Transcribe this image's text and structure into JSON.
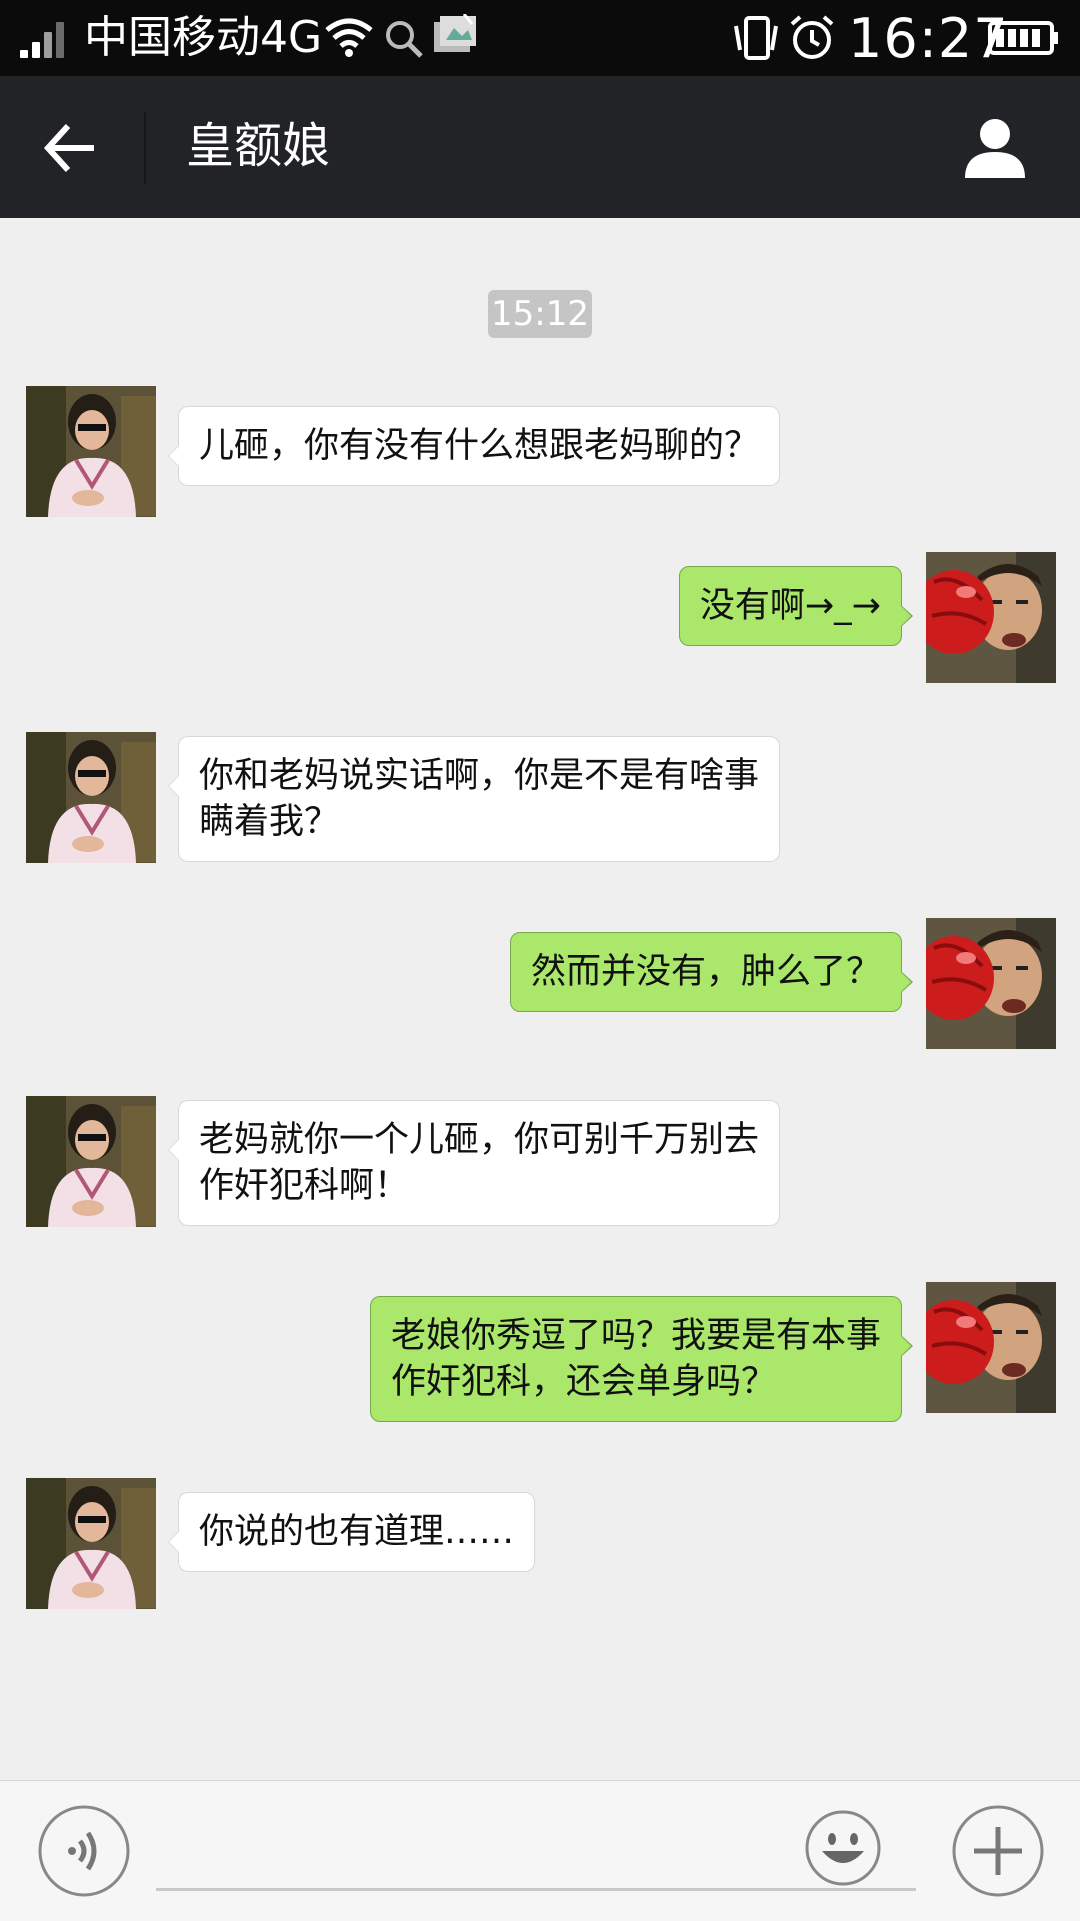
{
  "status_bar": {
    "carrier": "中国移动4G",
    "time": "16:27"
  },
  "header": {
    "title": "皇额娘"
  },
  "chat": {
    "timestamp": "15:12",
    "messages": [
      {
        "from": "mom",
        "text": "儿砸，你有没有什么想跟老妈聊的？"
      },
      {
        "from": "me",
        "text": "没有啊→_→"
      },
      {
        "from": "mom",
        "lines": [
          "你和老妈说实话啊，你是不是有啥事",
          "瞒着我？"
        ]
      },
      {
        "from": "me",
        "text": "然而并没有，肿么了？"
      },
      {
        "from": "mom",
        "lines": [
          "老妈就你一个儿砸，你可别千万别去",
          "作奸犯科啊！"
        ]
      },
      {
        "from": "me",
        "lines": [
          "老娘你秀逗了吗？我要是有本事",
          "作奸犯科，还会单身吗？"
        ]
      },
      {
        "from": "mom",
        "text": "你说的也有道理……"
      }
    ]
  },
  "input": {
    "value": "",
    "placeholder": ""
  },
  "icons": {
    "back": "arrow-left-icon",
    "profile": "person-icon",
    "voice": "voice-icon",
    "emoji": "smiley-icon",
    "more": "plus-icon"
  },
  "colors": {
    "title_bar": "#222327",
    "status_bar": "#0b0b0c",
    "sent_bubble": "#aae76a",
    "received_bubble": "#ffffff",
    "chat_bg": "#efefef"
  }
}
